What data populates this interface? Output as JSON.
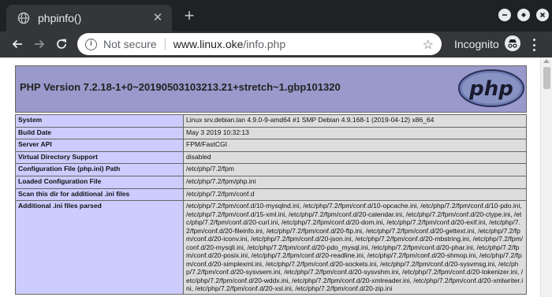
{
  "browser": {
    "tab_title": "phpinfo()",
    "tab_close": "✕",
    "new_tab": "+",
    "not_secure": "Not secure",
    "url_host": "www.linux.oke",
    "url_path": "/info.php",
    "incognito_label": "Incognito"
  },
  "php": {
    "version_title": "PHP Version 7.2.18-1+0~20190503103213.21+stretch~1.gbp101320",
    "logo_text": "php",
    "rows": [
      {
        "key": "System",
        "value": "Linux srv.debian.lan 4.9.0-9-amd64 #1 SMP Debian 4.9.168-1 (2019-04-12) x86_64"
      },
      {
        "key": "Build Date",
        "value": "May 3 2019 10:32:13"
      },
      {
        "key": "Server API",
        "value": "FPM/FastCGI"
      },
      {
        "key": "Virtual Directory Support",
        "value": "disabled"
      },
      {
        "key": "Configuration File (php.ini) Path",
        "value": "/etc/php/7.2/fpm"
      },
      {
        "key": "Loaded Configuration File",
        "value": "/etc/php/7.2/fpm/php.ini"
      },
      {
        "key": "Scan this dir for additional .ini files",
        "value": "/etc/php/7.2/fpm/conf.d"
      },
      {
        "key": "Additional .ini files parsed",
        "value": "/etc/php/7.2/fpm/conf.d/10-mysqlnd.ini, /etc/php/7.2/fpm/conf.d/10-opcache.ini, /etc/php/7.2/fpm/conf.d/10-pdo.ini, /etc/php/7.2/fpm/conf.d/15-xml.ini, /etc/php/7.2/fpm/conf.d/20-calendar.ini, /etc/php/7.2/fpm/conf.d/20-ctype.ini, /etc/php/7.2/fpm/conf.d/20-curl.ini, /etc/php/7.2/fpm/conf.d/20-dom.ini, /etc/php/7.2/fpm/conf.d/20-exif.ini, /etc/php/7.2/fpm/conf.d/20-fileinfo.ini, /etc/php/7.2/fpm/conf.d/20-ftp.ini, /etc/php/7.2/fpm/conf.d/20-gettext.ini, /etc/php/7.2/fpm/conf.d/20-iconv.ini, /etc/php/7.2/fpm/conf.d/20-json.ini, /etc/php/7.2/fpm/conf.d/20-mbstring.ini, /etc/php/7.2/fpm/conf.d/20-mysqli.ini, /etc/php/7.2/fpm/conf.d/20-pdo_mysql.ini, /etc/php/7.2/fpm/conf.d/20-phar.ini, /etc/php/7.2/fpm/conf.d/20-posix.ini, /etc/php/7.2/fpm/conf.d/20-readline.ini, /etc/php/7.2/fpm/conf.d/20-shmop.ini, /etc/php/7.2/fpm/conf.d/20-simplexml.ini, /etc/php/7.2/fpm/conf.d/20-sockets.ini, /etc/php/7.2/fpm/conf.d/20-sysvmsg.ini, /etc/php/7.2/fpm/conf.d/20-sysvsem.ini, /etc/php/7.2/fpm/conf.d/20-sysvshm.ini, /etc/php/7.2/fpm/conf.d/20-tokenizer.ini, /etc/php/7.2/fpm/conf.d/20-wddx.ini, /etc/php/7.2/fpm/conf.d/20-xmlreader.ini, /etc/php/7.2/fpm/conf.d/20-xmlwriter.ini, /etc/php/7.2/fpm/conf.d/20-xsl.ini, /etc/php/7.2/fpm/conf.d/20-zip.ini"
      }
    ]
  },
  "colors": {
    "header_bg": "#9999cc",
    "key_bg": "#ccccff",
    "value_bg": "#dddddd"
  },
  "icons": [
    "globe-icon",
    "back-arrow-icon",
    "forward-arrow-icon",
    "reload-icon",
    "info-icon",
    "star-icon",
    "incognito-icon",
    "menu-dots-icon",
    "minimize-icon",
    "maximize-icon",
    "close-window-icon"
  ]
}
